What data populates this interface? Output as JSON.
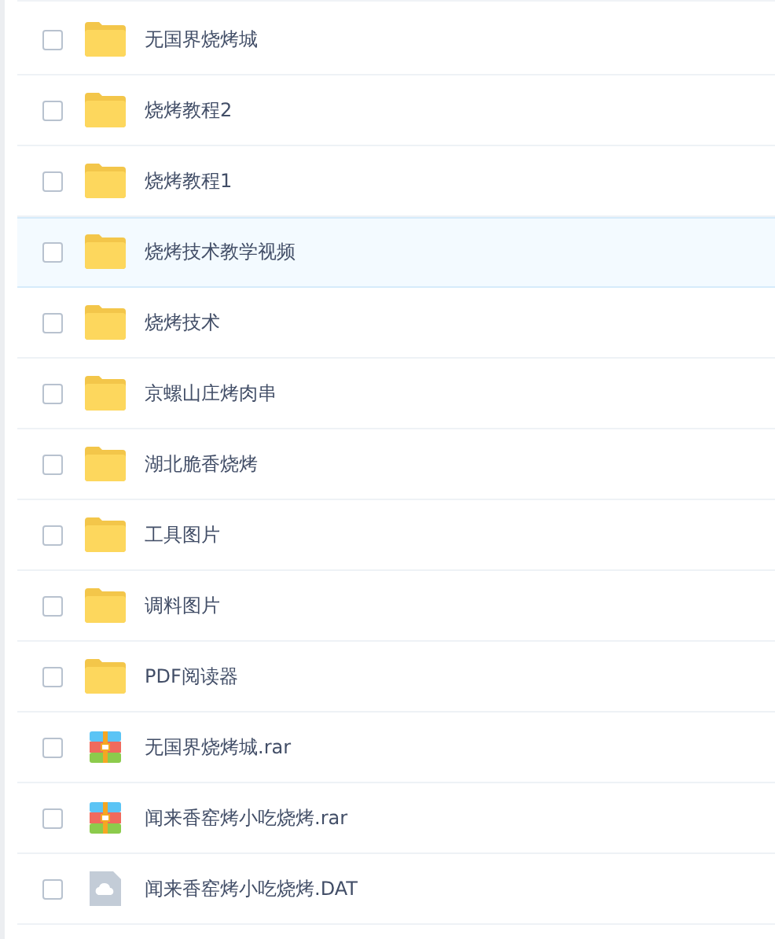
{
  "files": [
    {
      "name": "无国界烧烤城",
      "kind": "folder",
      "checked": false,
      "selected": false
    },
    {
      "name": "烧烤教程2",
      "kind": "folder",
      "checked": false,
      "selected": false
    },
    {
      "name": "烧烤教程1",
      "kind": "folder",
      "checked": false,
      "selected": false
    },
    {
      "name": "烧烤技术教学视频",
      "kind": "folder",
      "checked": false,
      "selected": true
    },
    {
      "name": "烧烤技术",
      "kind": "folder",
      "checked": false,
      "selected": false
    },
    {
      "name": "京螺山庄烤肉串",
      "kind": "folder",
      "checked": false,
      "selected": false
    },
    {
      "name": "湖北脆香烧烤",
      "kind": "folder",
      "checked": false,
      "selected": false
    },
    {
      "name": "工具图片",
      "kind": "folder",
      "checked": false,
      "selected": false
    },
    {
      "name": "调料图片",
      "kind": "folder",
      "checked": false,
      "selected": false
    },
    {
      "name": "PDF阅读器",
      "kind": "folder",
      "checked": false,
      "selected": false
    },
    {
      "name": "无国界烧烤城.rar",
      "kind": "archive",
      "checked": false,
      "selected": false
    },
    {
      "name": "闻来香窑烤小吃烧烤.rar",
      "kind": "archive",
      "checked": false,
      "selected": false
    },
    {
      "name": "闻来香窑烤小吃烧烤.DAT",
      "kind": "file",
      "checked": false,
      "selected": false
    }
  ]
}
